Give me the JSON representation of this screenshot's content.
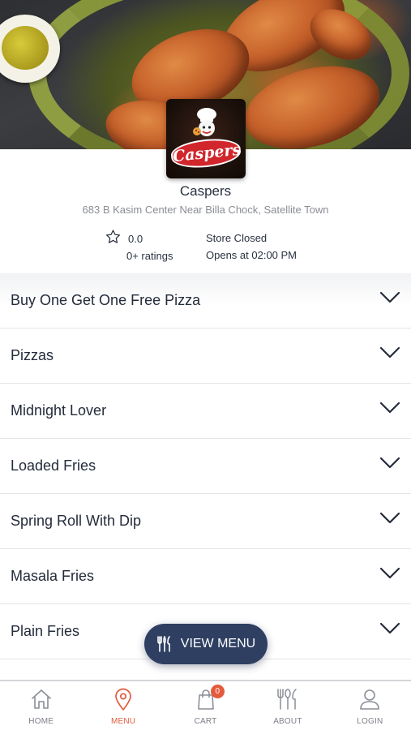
{
  "store": {
    "name": "Caspers",
    "address": "683 B Kasim Center Near Billa Chock, Satellite Town",
    "logo_text": "Caspers",
    "rating_value": "0.0",
    "rating_count": "0+ ratings",
    "status": "Store Closed",
    "opens_at": "Opens at 02:00 PM"
  },
  "categories": [
    {
      "label": "Buy One Get One Free Pizza"
    },
    {
      "label": "Pizzas"
    },
    {
      "label": "Midnight Lover"
    },
    {
      "label": "Loaded Fries"
    },
    {
      "label": "Spring Roll With Dip"
    },
    {
      "label": "Masala Fries"
    },
    {
      "label": "Plain Fries"
    }
  ],
  "view_menu": {
    "label": "VIEW MENU",
    "icon": "utensils-icon"
  },
  "bottom_nav": {
    "items": [
      {
        "label": "HOME",
        "icon": "home-icon"
      },
      {
        "label": "MENU",
        "icon": "map-pin-icon",
        "active": true
      },
      {
        "label": "CART",
        "icon": "cart-bag-icon",
        "badge": "0"
      },
      {
        "label": "ABOUT",
        "icon": "utensils-icon"
      },
      {
        "label": "LOGIN",
        "icon": "user-icon"
      }
    ]
  },
  "colors": {
    "primary_dark": "#2e3f62",
    "accent": "#e05a3f",
    "text_dark": "#242b3a",
    "text_muted": "#8a8d94"
  }
}
